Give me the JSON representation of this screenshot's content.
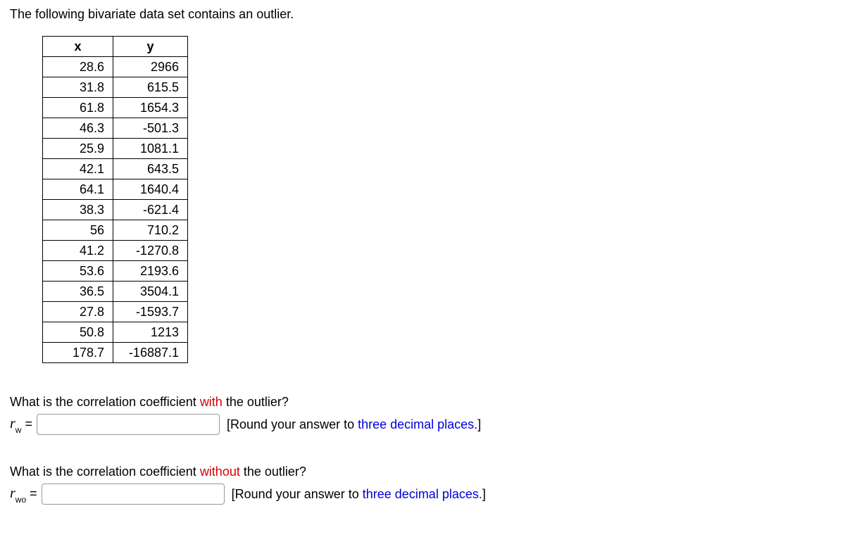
{
  "intro": "The following bivariate data set contains an outlier.",
  "headers": {
    "x": "x",
    "y": "y"
  },
  "rows": [
    {
      "x": "28.6",
      "y": "2966"
    },
    {
      "x": "31.8",
      "y": "615.5"
    },
    {
      "x": "61.8",
      "y": "1654.3"
    },
    {
      "x": "46.3",
      "y": "-501.3"
    },
    {
      "x": "25.9",
      "y": "1081.1"
    },
    {
      "x": "42.1",
      "y": "643.5"
    },
    {
      "x": "64.1",
      "y": "1640.4"
    },
    {
      "x": "38.3",
      "y": "-621.4"
    },
    {
      "x": "56",
      "y": "710.2"
    },
    {
      "x": "41.2",
      "y": "-1270.8"
    },
    {
      "x": "53.6",
      "y": "2193.6"
    },
    {
      "x": "36.5",
      "y": "3504.1"
    },
    {
      "x": "27.8",
      "y": "-1593.7"
    },
    {
      "x": "50.8",
      "y": "1213"
    },
    {
      "x": "178.7",
      "y": "-16887.1"
    }
  ],
  "q1": {
    "prefix": "What is the correlation coefficient ",
    "emph": "with",
    "suffix": " the outlier?",
    "label_r": "r",
    "label_sub": "w",
    "equals": " = ",
    "hint_open": "[Round your answer to ",
    "hint_emph": "three decimal places.",
    "hint_close": "]"
  },
  "q2": {
    "prefix": "What is the correlation coefficient ",
    "emph": "without",
    "suffix": " the outlier?",
    "label_r": "r",
    "label_sub": "wo",
    "equals": " = ",
    "hint_open": "[Round your answer to ",
    "hint_emph": "three decimal places.",
    "hint_close": "]"
  },
  "chart_data": {
    "type": "table",
    "columns": [
      "x",
      "y"
    ],
    "data": [
      [
        28.6,
        2966
      ],
      [
        31.8,
        615.5
      ],
      [
        61.8,
        1654.3
      ],
      [
        46.3,
        -501.3
      ],
      [
        25.9,
        1081.1
      ],
      [
        42.1,
        643.5
      ],
      [
        64.1,
        1640.4
      ],
      [
        38.3,
        -621.4
      ],
      [
        56,
        710.2
      ],
      [
        41.2,
        -1270.8
      ],
      [
        53.6,
        2193.6
      ],
      [
        36.5,
        3504.1
      ],
      [
        27.8,
        -1593.7
      ],
      [
        50.8,
        1213
      ],
      [
        178.7,
        -16887.1
      ]
    ]
  }
}
